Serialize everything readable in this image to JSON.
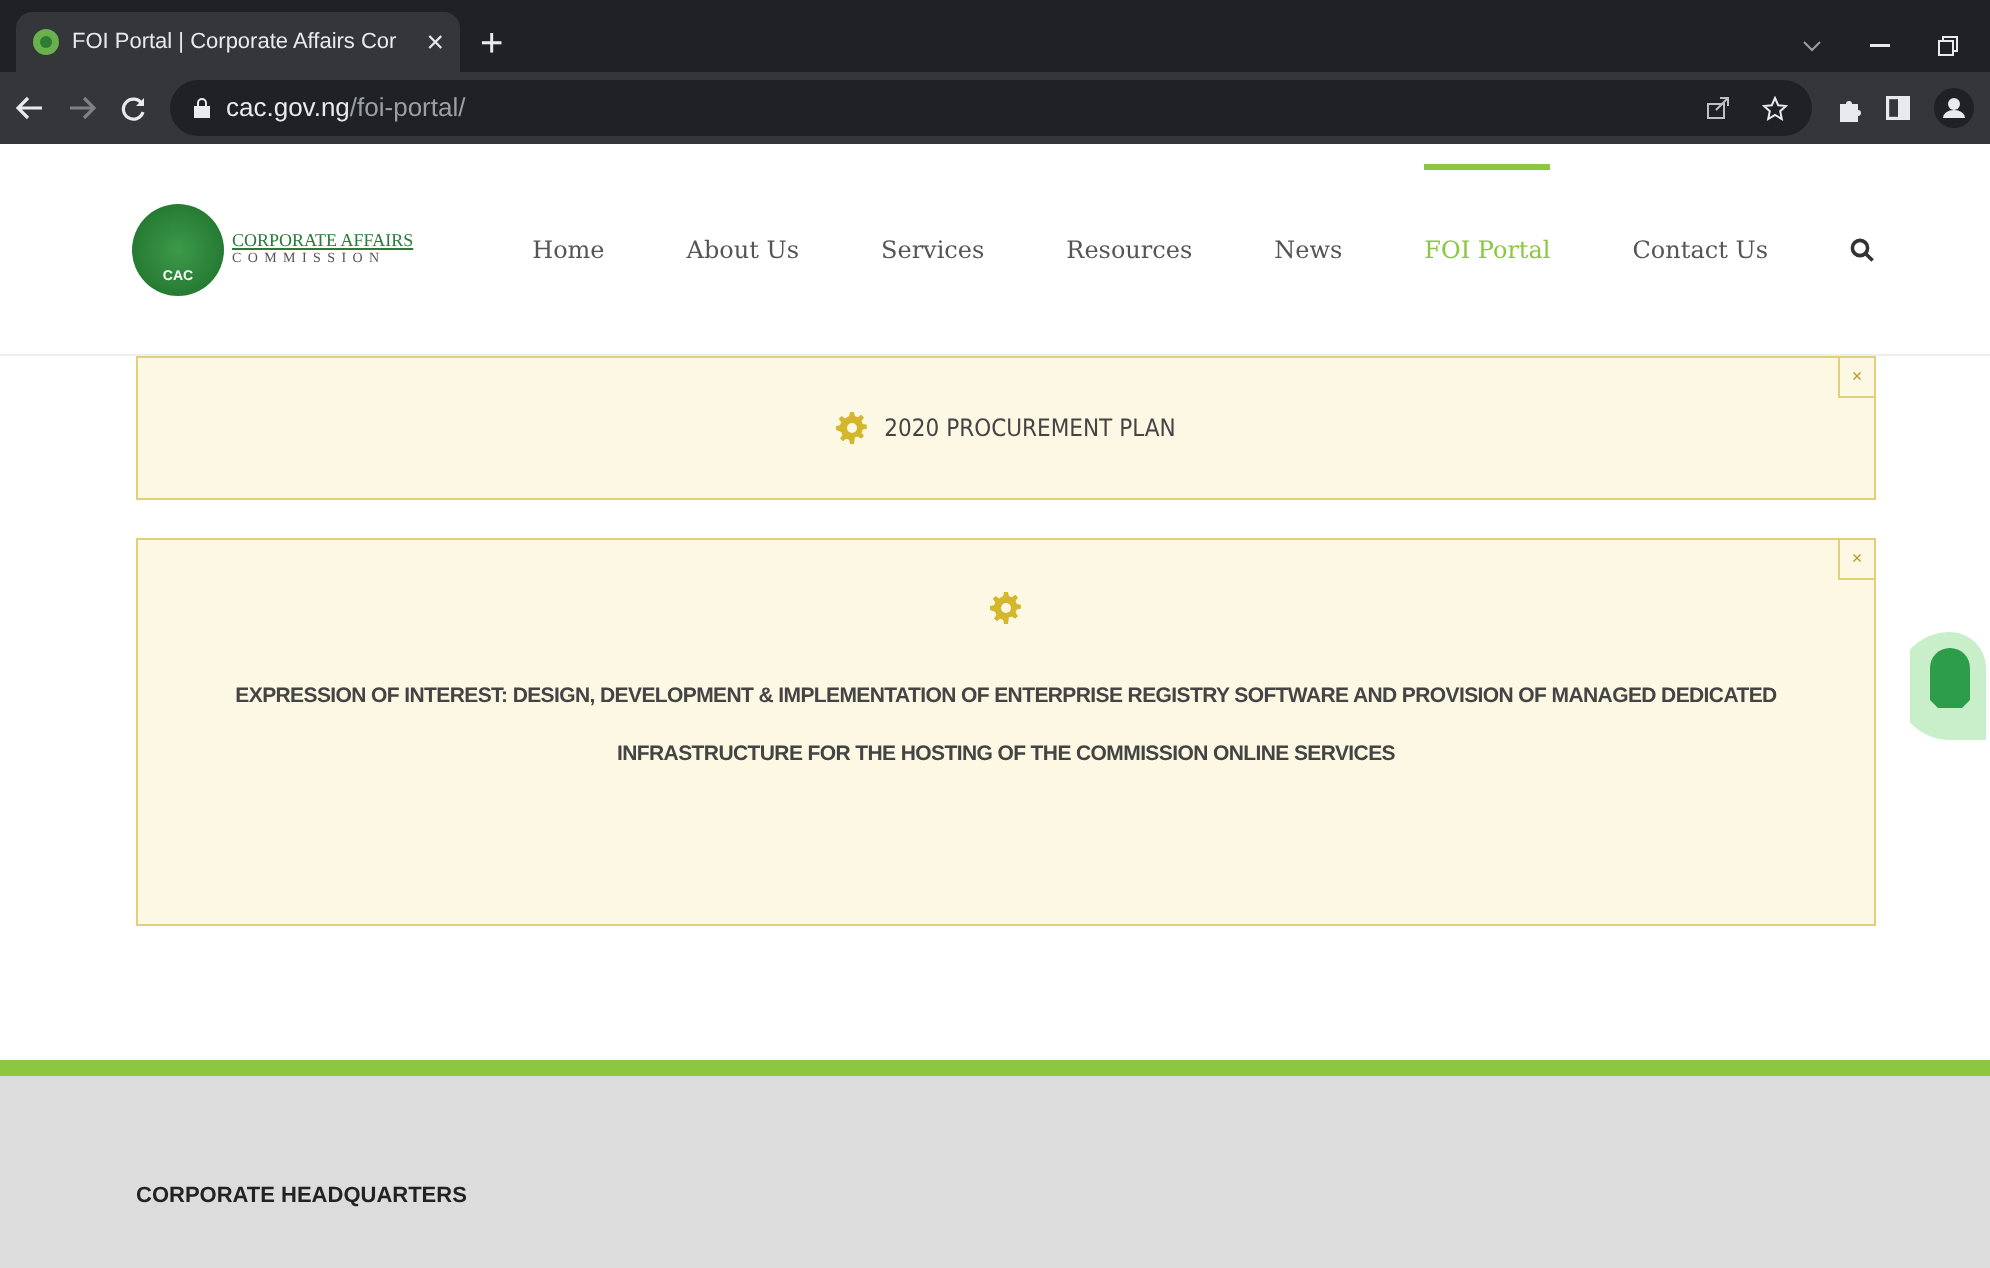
{
  "browser": {
    "tab_title": "FOI Portal | Corporate Affairs Cor",
    "tab_close": "×",
    "new_tab": "+",
    "url_host": "cac.gov.ng",
    "url_path": "/foi-portal/"
  },
  "header": {
    "logo": {
      "seal": "CAC",
      "line1": "CORPORATE AFFAIRS",
      "line2": "COMMISSION"
    },
    "nav": [
      {
        "label": "Home",
        "selected": false
      },
      {
        "label": "About Us",
        "selected": false
      },
      {
        "label": "Services",
        "selected": false
      },
      {
        "label": "Resources",
        "selected": false
      },
      {
        "label": "News",
        "selected": false
      },
      {
        "label": "FOI Portal",
        "selected": true
      },
      {
        "label": "Contact Us",
        "selected": false
      }
    ]
  },
  "notices": [
    {
      "kind": "inline",
      "title": "2020 PROCUREMENT PLAN",
      "close": "×"
    },
    {
      "kind": "stacked",
      "title": "EXPRESSION OF INTEREST: DESIGN, DEVELOPMENT & IMPLEMENTATION OF ENTERPRISE REGISTRY SOFTWARE AND PROVISION OF MANAGED DEDICATED INFRASTRUCTURE FOR THE HOSTING OF THE COMMISSION ONLINE SERVICES",
      "close": "×"
    }
  ],
  "footer": {
    "heading": "CORPORATE HEADQUARTERS"
  }
}
